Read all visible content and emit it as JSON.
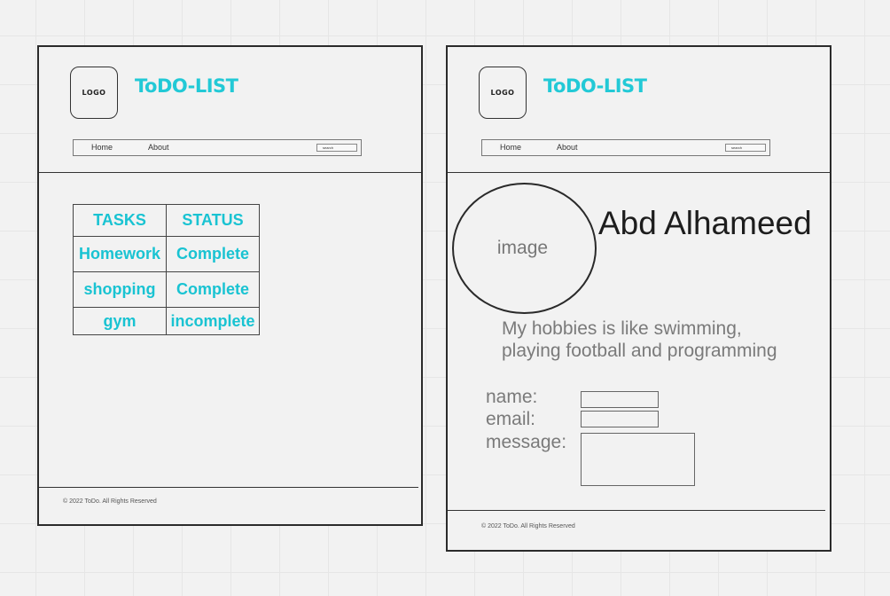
{
  "brand": {
    "logo_text": "LOGO",
    "title": "ToDO-LIST"
  },
  "nav": {
    "home": "Home",
    "about": "About",
    "search_placeholder": "search"
  },
  "tasks_table": {
    "headers": [
      "TASKS",
      "STATUS"
    ],
    "rows": [
      {
        "task": "Homework",
        "status": "Complete"
      },
      {
        "task": "shopping",
        "status": "Complete"
      },
      {
        "task": "gym",
        "status": "incomplete"
      }
    ]
  },
  "profile": {
    "image_placeholder": "image",
    "name": "Abd Alhameed",
    "bio_line1": "My hobbies is like swimming,",
    "bio_line2": "playing football and programming"
  },
  "contact_form": {
    "name_label": "name:",
    "email_label": "email:",
    "message_label": "message:"
  },
  "footer": {
    "copyright": "© 2022 ToDo. All Rights Reserved"
  },
  "colors": {
    "accent": "#22c9d6",
    "frame_border": "#2b2b2b",
    "canvas": "#f2f2f2"
  }
}
